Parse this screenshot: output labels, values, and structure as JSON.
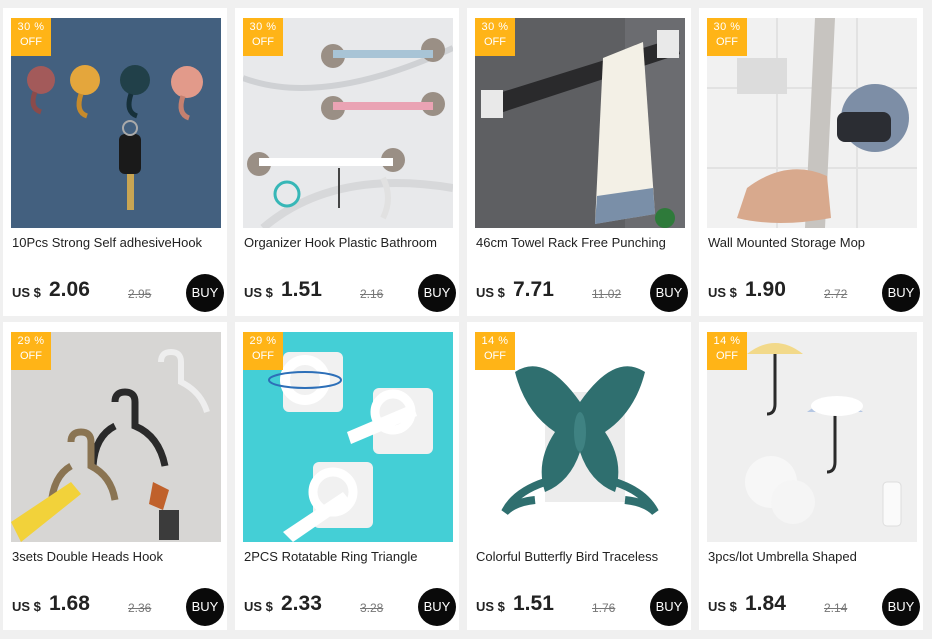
{
  "currency_label": "US $",
  "buy_label": "BUY",
  "off_label": "OFF",
  "colors": {
    "badge": "#ffb417",
    "buy_button": "#0a0a0a",
    "background": "#f0f0f0"
  },
  "products": [
    {
      "discount": "30 %",
      "title": "10Pcs Strong Self adhesiveHook",
      "price": "2.06",
      "old_price": "2.95",
      "image": "colorful-adhesive-hooks-with-keys"
    },
    {
      "discount": "30 %",
      "title": "Organizer Hook Plastic Bathroom",
      "price": "1.51",
      "old_price": "2.16",
      "image": "multi-hook-racks-on-marble"
    },
    {
      "discount": "30 %",
      "title": "46cm Towel Rack Free Punching",
      "price": "7.71",
      "old_price": "11.02",
      "image": "towel-rack-with-towel"
    },
    {
      "discount": "30 %",
      "title": "Wall Mounted Storage Mop",
      "price": "1.90",
      "old_price": "2.72",
      "image": "mop-holder-with-hand"
    },
    {
      "discount": "29 %",
      "title": "3sets Double Heads Hook",
      "price": "1.68",
      "old_price": "2.36",
      "image": "double-metal-hooks-with-keys"
    },
    {
      "discount": "29 %",
      "title": "2PCS Rotatable Ring Triangle",
      "price": "2.33",
      "old_price": "3.28",
      "image": "rotatable-rod-holders-on-teal"
    },
    {
      "discount": "14 %",
      "title": "Colorful Butterfly Bird Traceless",
      "price": "1.51",
      "old_price": "1.76",
      "image": "butterfly-hook"
    },
    {
      "discount": "14 %",
      "title": "3pcs/lot Umbrella Shaped",
      "price": "1.84",
      "old_price": "2.14",
      "image": "umbrella-shaped-hooks"
    }
  ]
}
